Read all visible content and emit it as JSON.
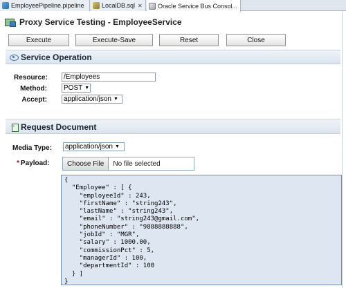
{
  "tabs": [
    {
      "label": "EmployeePipeline.pipeline",
      "icon": "pipeline-icon"
    },
    {
      "label": "LocalDB.sql",
      "icon": "database-icon"
    },
    {
      "label": "Oracle Service Bus Consol...",
      "icon": "console-icon"
    }
  ],
  "header": {
    "title": "Proxy Service Testing - EmployeeService"
  },
  "toolbar": {
    "execute_label": "Execute",
    "execute_save_label": "Execute-Save",
    "reset_label": "Reset",
    "close_label": "Close"
  },
  "service_operation": {
    "title": "Service Operation",
    "resource_label": "Resource:",
    "resource_value": "/Employees",
    "method_label": "Method:",
    "method_value": "POST",
    "accept_label": "Accept:",
    "accept_value": "application/json"
  },
  "request_document": {
    "title": "Request Document",
    "media_type_label": "Media Type:",
    "media_type_value": "application/json",
    "payload_label": "Payload:",
    "required_marker": "*",
    "choose_file_label": "Choose File",
    "no_file_text": "No file selected",
    "payload_text": "{\n  \"Employee\" : [ {\n    \"employeeId\" : 243,\n    \"firstName\" : \"string243\",\n    \"lastName\" : \"string243\",\n    \"email\" : \"string243@gmail.com\",\n    \"phoneNumber\" : \"9888888888\",\n    \"jobId\" : \"MGR\",\n    \"salary\" : 1000.00,\n    \"commissionPct\" : 5,\n    \"managerId\" : 100,\n    \"departmentId\" : 100\n  } ]\n}"
  }
}
